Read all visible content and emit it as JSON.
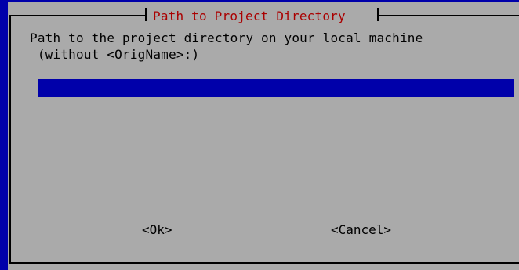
{
  "dialog": {
    "title": "Path to Project Directory",
    "prompt_line1": "Path to the project directory on your local machine",
    "prompt_line2": " (without <OrigName>:)",
    "input_value": "",
    "cursor": "_"
  },
  "buttons": {
    "ok_label": "<Ok>",
    "cancel_label": "<Cancel>"
  },
  "colors": {
    "background": "#0000aa",
    "dialog": "#aaaaaa",
    "title": "#aa0000",
    "input": "#0000aa"
  }
}
